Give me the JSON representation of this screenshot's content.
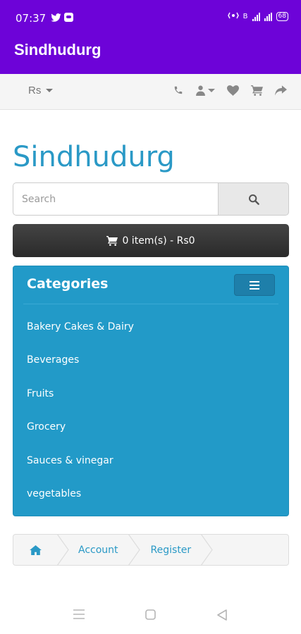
{
  "status_bar": {
    "time": "07:37",
    "network_text": "B",
    "battery": "68",
    "icons": [
      "twitter-icon",
      "message-icon",
      "hotspot-icon",
      "volte-icon",
      "signal-icon",
      "wifi-signal-icon",
      "battery-icon"
    ]
  },
  "app_bar": {
    "title": "Sindhudurg"
  },
  "top_nav": {
    "currency": "Rs",
    "icons": [
      "phone-icon",
      "user-icon",
      "heart-icon",
      "cart-icon",
      "share-icon"
    ]
  },
  "store": {
    "title": "Sindhudurg"
  },
  "search": {
    "placeholder": "Search",
    "value": ""
  },
  "cart": {
    "label": "0 item(s) - Rs0"
  },
  "categories": {
    "title": "Categories",
    "items": [
      {
        "label": "Bakery Cakes & Dairy"
      },
      {
        "label": "Beverages"
      },
      {
        "label": "Fruits"
      },
      {
        "label": "Grocery"
      },
      {
        "label": "Sauces & vinegar"
      },
      {
        "label": "vegetables"
      }
    ]
  },
  "breadcrumb": {
    "items": [
      {
        "label": "home-icon"
      },
      {
        "label": "Account"
      },
      {
        "label": "Register"
      }
    ]
  },
  "colors": {
    "app_bar": "#6d03d8",
    "accent": "#2a99c6",
    "panel": "#229ac8"
  }
}
